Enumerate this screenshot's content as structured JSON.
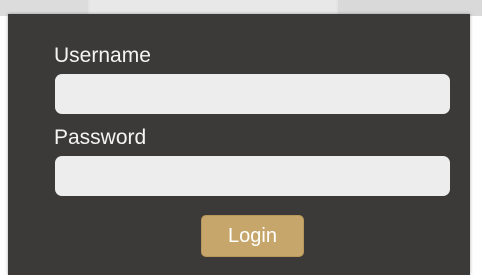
{
  "login_form": {
    "username_label": "Username",
    "username_value": "",
    "password_label": "Password",
    "password_value": "",
    "login_label": "Login"
  },
  "colors": {
    "panel_background": "#3b3a39",
    "input_background": "#ededed",
    "login_button": "#c6a66b",
    "label_text": "#f4f4f4"
  }
}
